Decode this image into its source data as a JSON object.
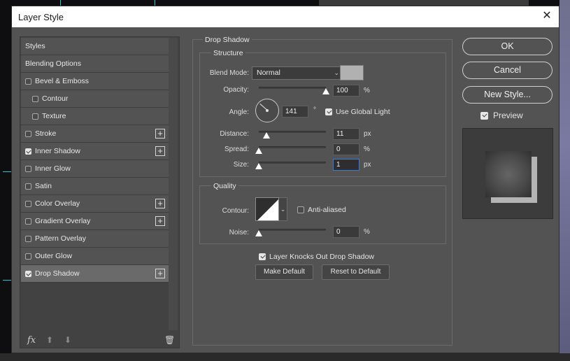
{
  "dialog": {
    "title": "Layer Style",
    "close_glyph": "✕"
  },
  "styles_panel": {
    "items": [
      {
        "label": "Styles",
        "checkbox": false,
        "checked": false,
        "plus": false,
        "sub": false,
        "selected": false
      },
      {
        "label": "Blending Options",
        "checkbox": false,
        "checked": false,
        "plus": false,
        "sub": false,
        "selected": false
      },
      {
        "label": "Bevel & Emboss",
        "checkbox": true,
        "checked": false,
        "plus": false,
        "sub": false,
        "selected": false
      },
      {
        "label": "Contour",
        "checkbox": true,
        "checked": false,
        "plus": false,
        "sub": true,
        "selected": false
      },
      {
        "label": "Texture",
        "checkbox": true,
        "checked": false,
        "plus": false,
        "sub": true,
        "selected": false
      },
      {
        "label": "Stroke",
        "checkbox": true,
        "checked": false,
        "plus": true,
        "sub": false,
        "selected": false
      },
      {
        "label": "Inner Shadow",
        "checkbox": true,
        "checked": true,
        "plus": true,
        "sub": false,
        "selected": false
      },
      {
        "label": "Inner Glow",
        "checkbox": true,
        "checked": false,
        "plus": false,
        "sub": false,
        "selected": false
      },
      {
        "label": "Satin",
        "checkbox": true,
        "checked": false,
        "plus": false,
        "sub": false,
        "selected": false
      },
      {
        "label": "Color Overlay",
        "checkbox": true,
        "checked": false,
        "plus": true,
        "sub": false,
        "selected": false
      },
      {
        "label": "Gradient Overlay",
        "checkbox": true,
        "checked": false,
        "plus": true,
        "sub": false,
        "selected": false
      },
      {
        "label": "Pattern Overlay",
        "checkbox": true,
        "checked": false,
        "plus": false,
        "sub": false,
        "selected": false
      },
      {
        "label": "Outer Glow",
        "checkbox": true,
        "checked": false,
        "plus": false,
        "sub": false,
        "selected": false
      },
      {
        "label": "Drop Shadow",
        "checkbox": true,
        "checked": true,
        "plus": true,
        "sub": false,
        "selected": true
      }
    ],
    "plus_glyph": "+",
    "footer": {
      "fx": "fx",
      "up": "⬆",
      "down": "⬇",
      "trash": "🗑"
    }
  },
  "drop_shadow": {
    "title": "Drop Shadow",
    "structure": {
      "title": "Structure",
      "blend_mode_label": "Blend Mode:",
      "blend_mode_value": "Normal",
      "shadow_color": "#b1b1b1",
      "opacity_label": "Opacity:",
      "opacity_value": "100",
      "opacity_unit": "%",
      "opacity_fraction": 1.0,
      "angle_label": "Angle:",
      "angle_value": "141",
      "angle_unit": "°",
      "use_global_light_label": "Use Global Light",
      "use_global_light_checked": true,
      "distance_label": "Distance:",
      "distance_value": "11",
      "distance_unit": "px",
      "distance_fraction": 0.11,
      "spread_label": "Spread:",
      "spread_value": "0",
      "spread_unit": "%",
      "spread_fraction": 0.0,
      "size_label": "Size:",
      "size_value": "1",
      "size_unit": "px",
      "size_fraction": 0.005
    },
    "quality": {
      "title": "Quality",
      "contour_label": "Contour:",
      "anti_aliased_label": "Anti-aliased",
      "anti_aliased_checked": false,
      "noise_label": "Noise:",
      "noise_value": "0",
      "noise_unit": "%",
      "noise_fraction": 0.0
    },
    "knocks_out_label": "Layer Knocks Out Drop Shadow",
    "knocks_out_checked": true,
    "make_default_label": "Make Default",
    "reset_default_label": "Reset to Default"
  },
  "actions": {
    "ok_label": "OK",
    "cancel_label": "Cancel",
    "new_style_label": "New Style...",
    "preview_label": "Preview",
    "preview_checked": true
  }
}
